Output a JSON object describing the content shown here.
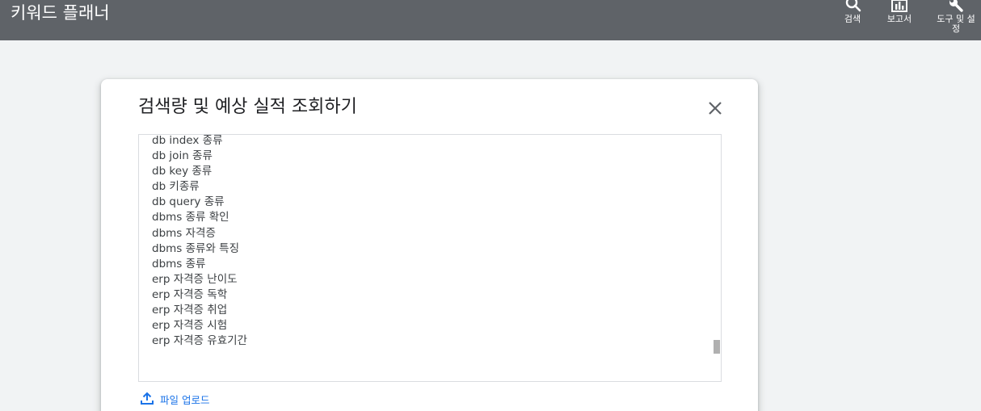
{
  "header": {
    "app_title": "키워드 플래너",
    "tools": [
      {
        "label": "검색",
        "icon": "search-icon"
      },
      {
        "label": "보고서",
        "icon": "bar-chart-icon"
      },
      {
        "label_line1": "도구 및 설",
        "label_line2": "정",
        "icon": "wrench-icon"
      }
    ]
  },
  "dialog": {
    "title": "검색량 및 예상 실적 조회하기",
    "close_icon": "close-icon",
    "keywords": [
      "db index 종류",
      "db join 종류",
      "db key 종류",
      "db 키종류",
      "db query 종류",
      "dbms 종류 확인",
      "dbms 자격증",
      "dbms 종류와 특징",
      "dbms 종류",
      "erp 자격증 난이도",
      "erp 자격증 독학",
      "erp 자격증 취업",
      "erp 자격증 시험",
      "erp 자격증 유효기간"
    ],
    "upload_label": "파일 업로드",
    "upload_icon": "upload-icon"
  },
  "colors": {
    "topbar": "#5f6368",
    "background": "#f1f3f4",
    "link": "#1a73e8",
    "text": "#3c4043"
  }
}
